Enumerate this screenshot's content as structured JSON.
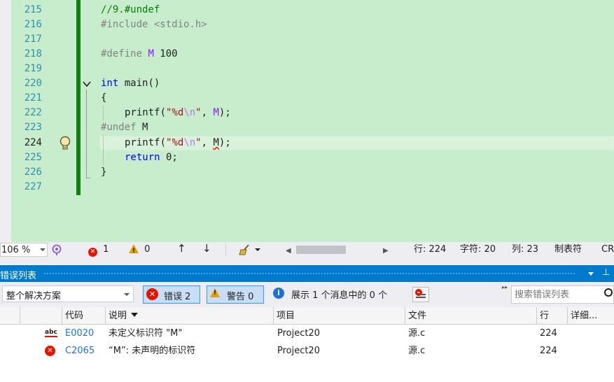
{
  "editor": {
    "line_numbers": [
      "215",
      "216",
      "217",
      "218",
      "219",
      "220",
      "221",
      "222",
      "223",
      "224",
      "225",
      "226",
      "227"
    ],
    "current_line": "224",
    "code": {
      "l215": "//9.#undef",
      "l216_kw": "#include ",
      "l216_arg": "<stdio.h>",
      "l218_kw": "#define ",
      "l218_macro": "M",
      "l218_val": " 100",
      "l220_kw": "int",
      "l220_rest": " main()",
      "l221": "{",
      "l222_fn": "printf",
      "l222_p1": "(",
      "l222_s1": "\"%d",
      "l222_esc": "\\n",
      "l222_s2": "\"",
      "l222_p2": ", ",
      "l222_macro": "M",
      "l222_p3": ");",
      "l223_kw": "#undef",
      "l223_rest": " M",
      "l224_fn": "printf",
      "l224_p1": "(",
      "l224_s1": "\"%d",
      "l224_esc": "\\n",
      "l224_s2": "\"",
      "l224_p2": ", ",
      "l224_err": "M",
      "l224_p3": ");",
      "l225_kw": "return",
      "l225_rest": " 0;",
      "l226": "}"
    }
  },
  "status_bar": {
    "zoom": "106 %",
    "errors_count": "1",
    "warnings_count": "0",
    "row": "行: 224",
    "char": "字符: 20",
    "col": "列: 23",
    "tabs": "制表符",
    "line_ending": "CR"
  },
  "error_list": {
    "title": "错误列表",
    "scope": "整个解决方案",
    "errors_button": "错误 2",
    "warnings_button": "警告 0",
    "messages_info": "展示 1 个消息中的 0 个",
    "search_placeholder": "搜索错误列表",
    "columns": {
      "code": "代码",
      "description": "说明",
      "project": "项目",
      "file": "文件",
      "line": "行",
      "details": "详细..."
    },
    "rows": [
      {
        "icon": "spell-error-icon",
        "code": "E0020",
        "description": "未定义标识符 \"M\"",
        "project": "Project20",
        "file": "源.c",
        "line": "224"
      },
      {
        "icon": "error-icon",
        "code": "C2065",
        "description": "“M”: 未声明的标识符",
        "project": "Project20",
        "file": "源.c",
        "line": "224"
      }
    ]
  },
  "colors": {
    "editor_background": "#c7edcc",
    "change_bar": "#108010",
    "accent": "#007acc",
    "error": "#e51400",
    "warning": "#e0a100"
  }
}
